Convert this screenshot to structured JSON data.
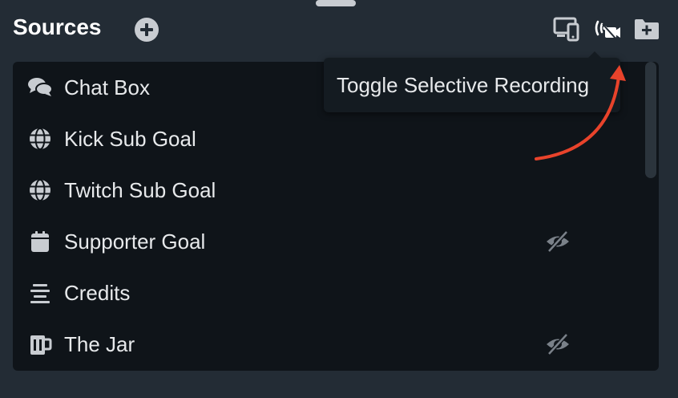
{
  "header": {
    "title": "Sources",
    "add_icon": "plus-circle-icon",
    "tools": [
      {
        "name": "devices-icon",
        "tooltip": ""
      },
      {
        "name": "selective-recording-icon",
        "tooltip": "Toggle Selective Recording"
      },
      {
        "name": "add-folder-icon",
        "tooltip": ""
      }
    ]
  },
  "tooltip": {
    "text": "Toggle Selective Recording"
  },
  "sources": [
    {
      "label": "Chat Box",
      "icon": "chat-bubbles-icon",
      "hidden": false
    },
    {
      "label": "Kick Sub Goal",
      "icon": "globe-icon",
      "hidden": false
    },
    {
      "label": "Twitch Sub Goal",
      "icon": "globe-icon",
      "hidden": false
    },
    {
      "label": "Supporter Goal",
      "icon": "calendar-icon",
      "hidden": true
    },
    {
      "label": "Credits",
      "icon": "align-center-icon",
      "hidden": false
    },
    {
      "label": "The Jar",
      "icon": "mug-icon",
      "hidden": true
    }
  ],
  "colors": {
    "background": "#232c35",
    "list_background": "#0f1419",
    "text": "#e7e9eb",
    "icon": "#c8ccd1",
    "annotation_arrow": "#e8432b"
  }
}
